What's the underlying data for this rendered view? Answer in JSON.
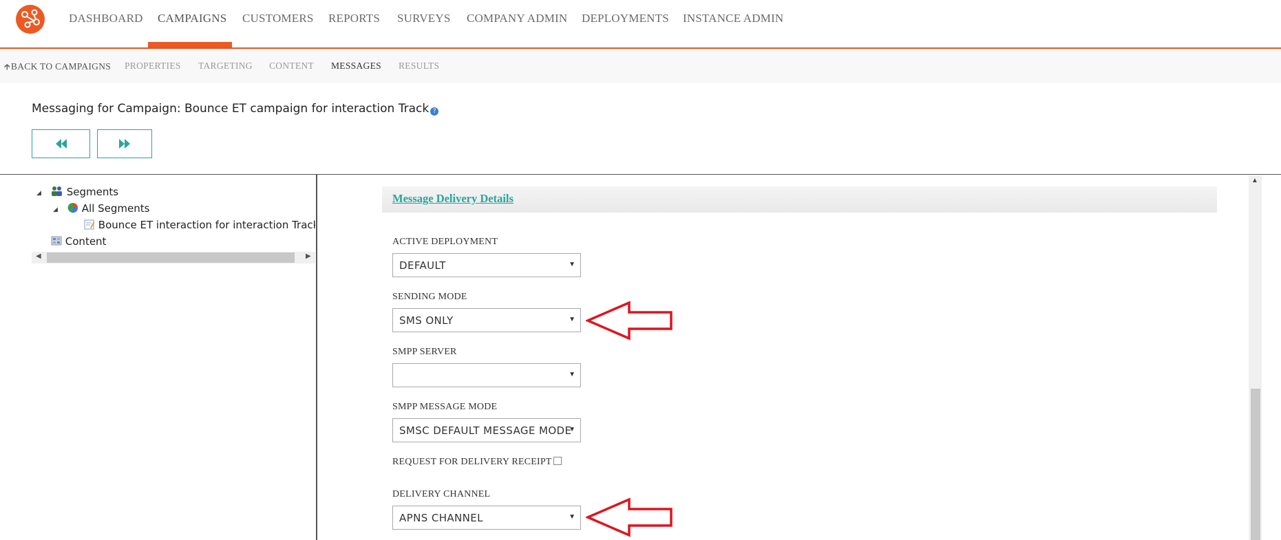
{
  "topnav": {
    "items": [
      "DASHBOARD",
      "CAMPAIGNS",
      "CUSTOMERS",
      "REPORTS",
      "SURVEYS",
      "COMPANY ADMIN",
      "DEPLOYMENTS",
      "INSTANCE ADMIN"
    ],
    "active": "CAMPAIGNS"
  },
  "subnav": {
    "back": "BACK TO CAMPAIGNS",
    "items": [
      "PROPERTIES",
      "TARGETING",
      "CONTENT",
      "MESSAGES",
      "RESULTS"
    ],
    "active": "MESSAGES"
  },
  "page": {
    "title": "Messaging for Campaign: Bounce ET campaign for interaction Track"
  },
  "tree": {
    "segments": "Segments",
    "all_segments": "All Segments",
    "message_item": "Bounce ET interaction for interaction Track",
    "content": "Content"
  },
  "section": {
    "header": "Message Delivery Details"
  },
  "form": {
    "active_deployment": {
      "label": "ACTIVE DEPLOYMENT",
      "value": "DEFAULT"
    },
    "sending_mode": {
      "label": "SENDING MODE",
      "value": "SMS ONLY"
    },
    "smpp_server": {
      "label": "SMPP SERVER",
      "value": ""
    },
    "smpp_message_mode": {
      "label": "SMPP MESSAGE MODE",
      "value": "SMSC DEFAULT MESSAGE MODE"
    },
    "delivery_receipt": {
      "label": "REQUEST FOR DELIVERY RECEIPT",
      "checked": false
    },
    "delivery_channel": {
      "label": "DELIVERY CHANNEL",
      "value": "APNS CHANNEL"
    }
  },
  "colors": {
    "brand": "#ec5a24",
    "accent": "#2aa59b",
    "annotation": "#e0141e"
  }
}
